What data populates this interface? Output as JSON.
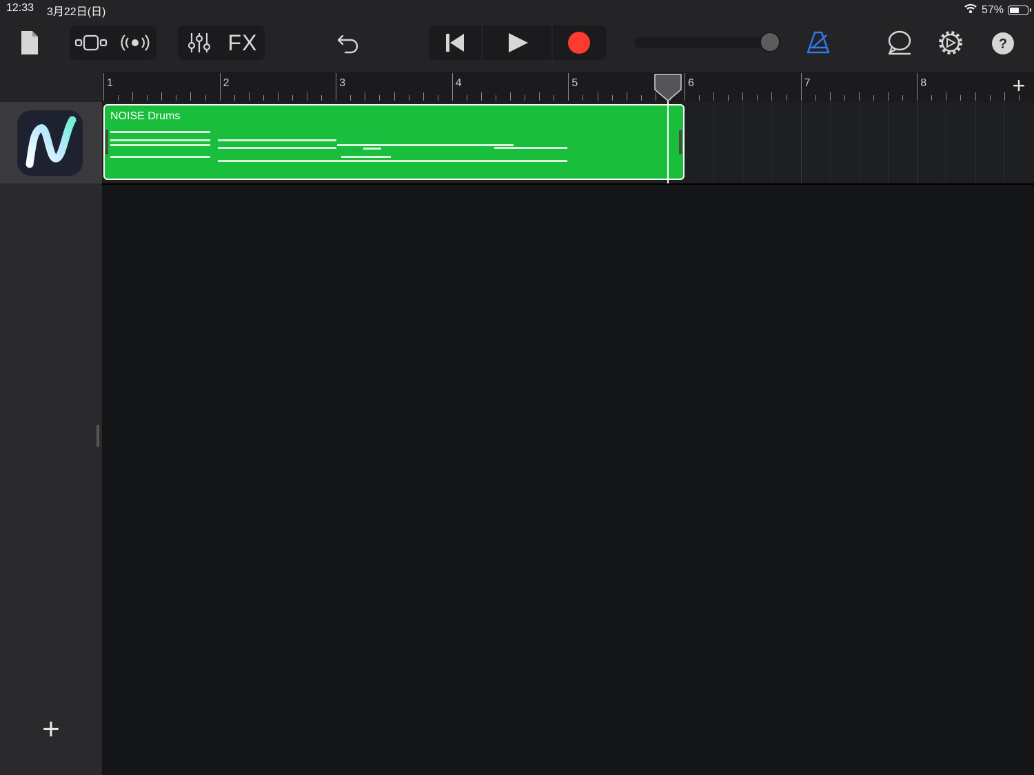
{
  "status_bar": {
    "time": "12:33",
    "date": "3月22日(日)",
    "battery_percent": "57%",
    "battery_level": 0.57
  },
  "toolbar": {
    "fx_label": "FX",
    "icons": [
      "document-icon",
      "browser-icon",
      "live-loops-icon",
      "mixer-icon",
      "fx",
      "undo-icon",
      "go-to-start-icon",
      "play-icon",
      "record-icon",
      "metronome-icon",
      "loop-icon",
      "settings-icon",
      "help-icon"
    ],
    "record_color": "#ff3b30",
    "metronome_color": "#2f7cf6",
    "help_label": "?"
  },
  "ruler": {
    "bars": [
      "1",
      "2",
      "3",
      "4",
      "5",
      "6",
      "7",
      "8"
    ],
    "add_label": "+"
  },
  "track": {
    "region_name": "NOISE Drums",
    "region_color": "#19be3c",
    "instrument_icon": "noise-app-icon"
  },
  "sidebar": {
    "add_track_label": "+"
  }
}
